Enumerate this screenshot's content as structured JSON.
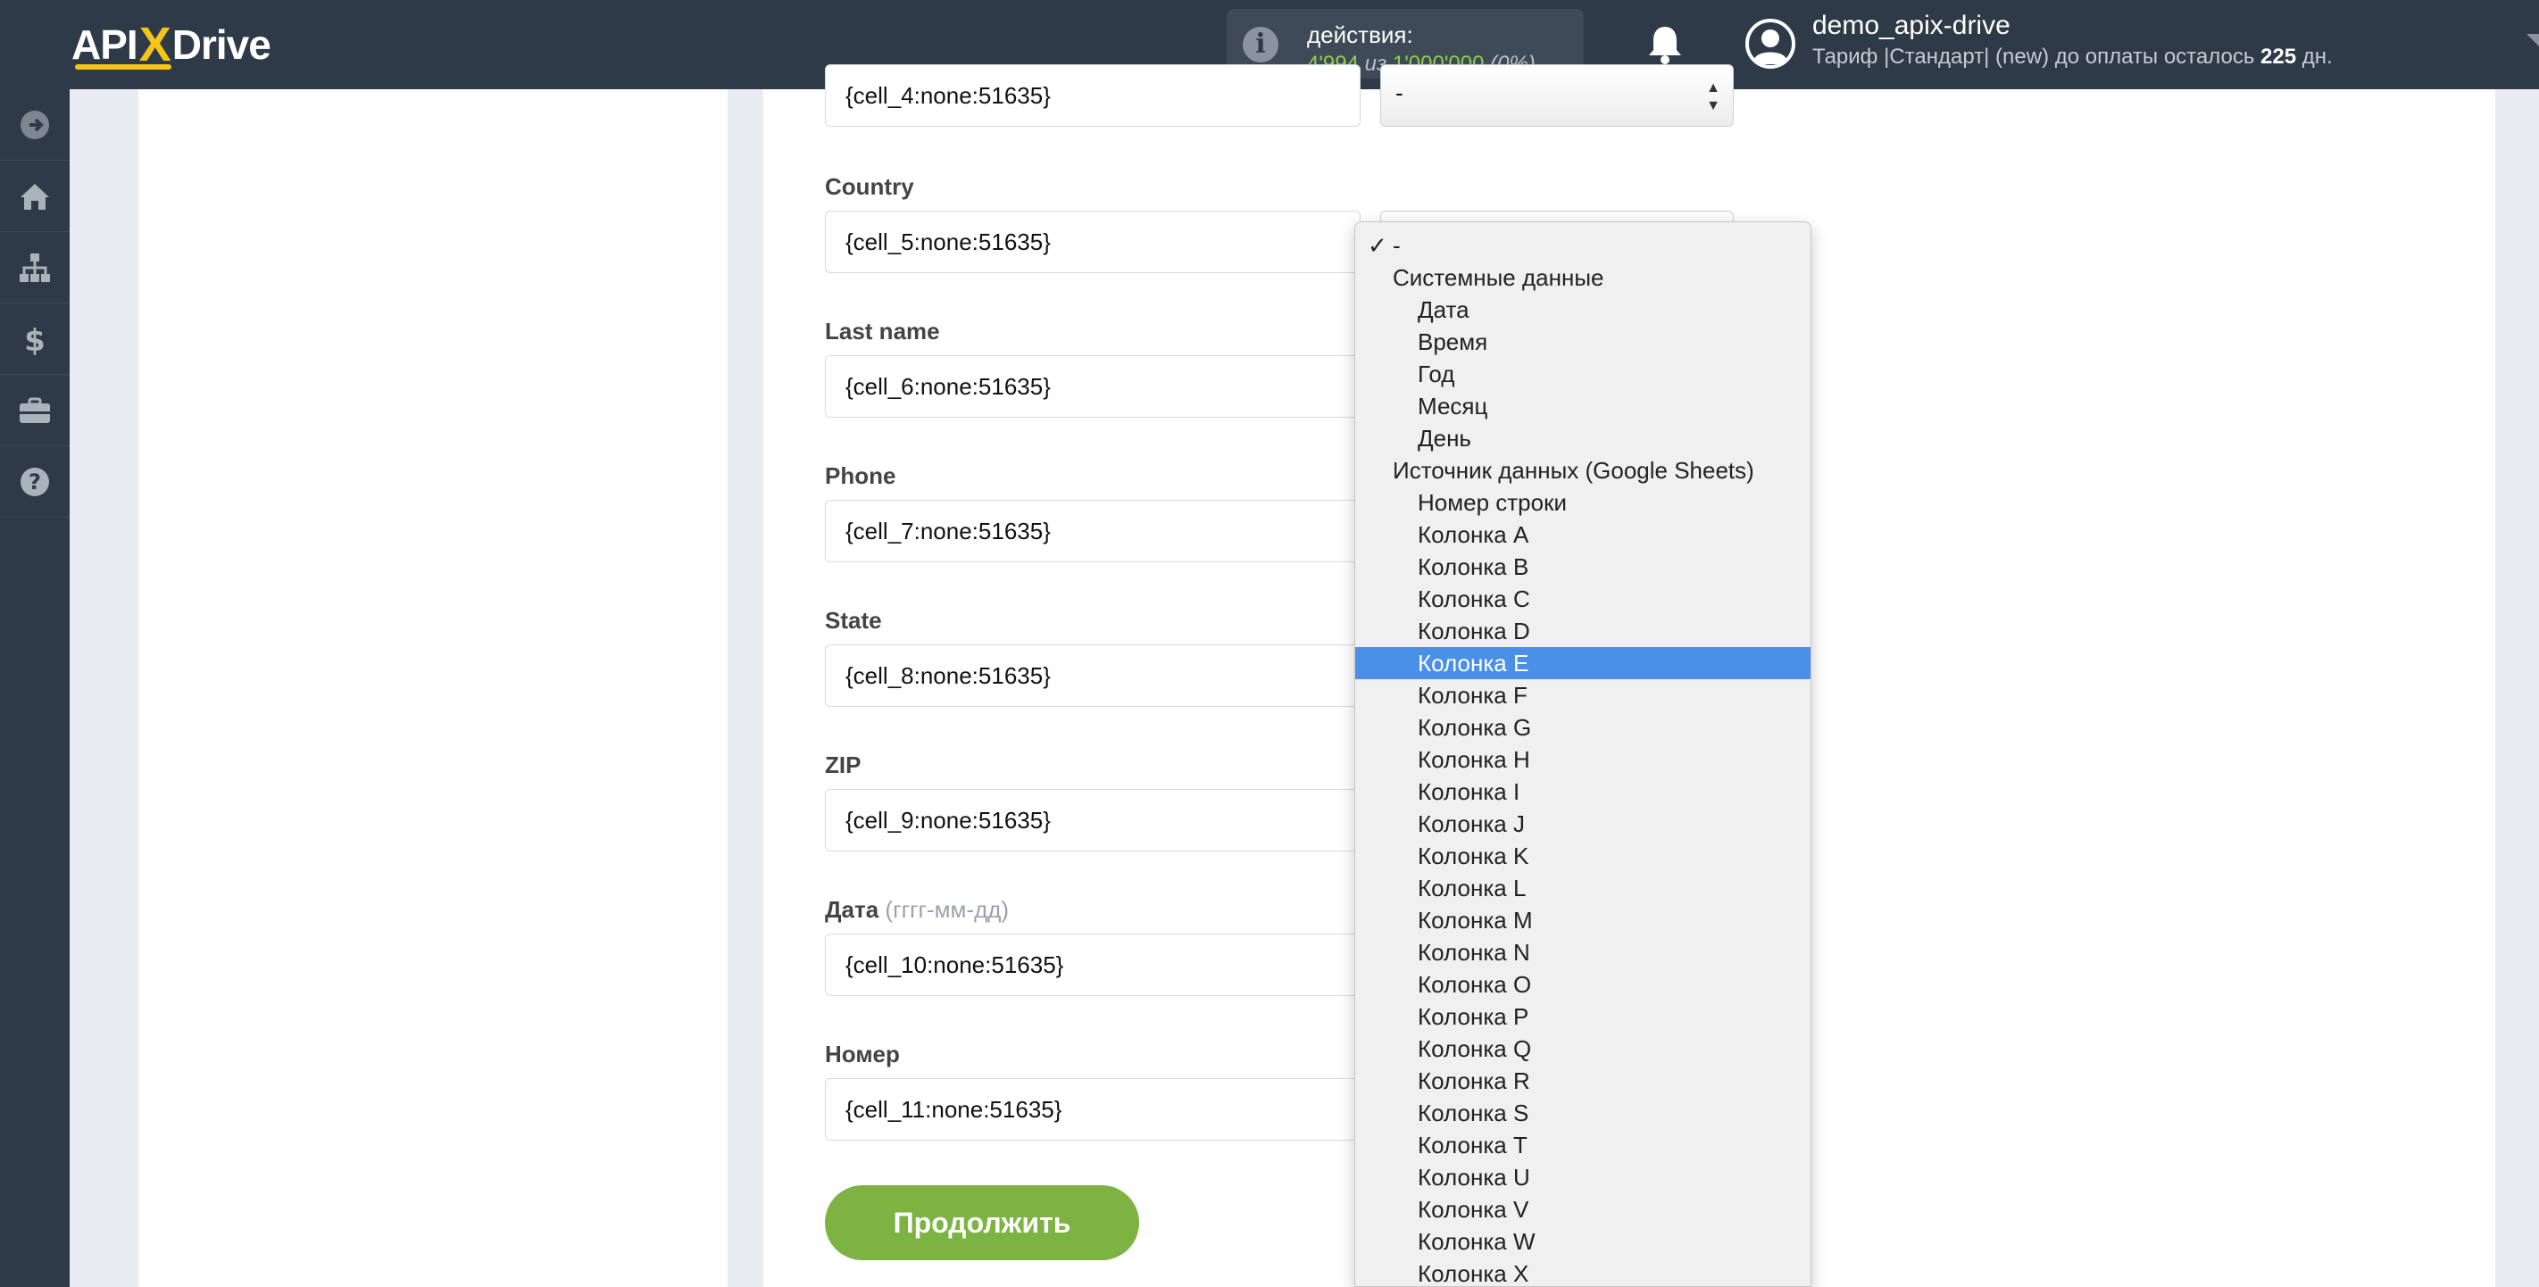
{
  "header": {
    "logo": {
      "part1": "API",
      "x": "X",
      "part2": "Drive"
    },
    "actions": {
      "label": "действия:",
      "used": "4'994",
      "of_word": "из",
      "total": "1'000'000",
      "percent": "(0%)"
    },
    "user": {
      "name": "demo_apix-drive",
      "plan_prefix": "Тариф |Стандарт| (new) до оплаты осталось",
      "days": "225",
      "days_suffix": "дн."
    }
  },
  "sidebar": {
    "items": [
      {
        "icon": "arrow-right-circle-icon"
      },
      {
        "icon": "home-icon"
      },
      {
        "icon": "sitemap-icon"
      },
      {
        "icon": "dollar-icon"
      },
      {
        "icon": "briefcase-icon"
      },
      {
        "icon": "help-icon"
      }
    ]
  },
  "form": {
    "fields": [
      {
        "label": "",
        "value": "{cell_4:none:51635}",
        "select": "-"
      },
      {
        "label": "Country",
        "value": "{cell_5:none:51635}",
        "select": ""
      },
      {
        "label": "Last name",
        "value": "{cell_6:none:51635}"
      },
      {
        "label": "Phone",
        "value": "{cell_7:none:51635}"
      },
      {
        "label": "State",
        "value": "{cell_8:none:51635}"
      },
      {
        "label": "ZIP",
        "value": "{cell_9:none:51635}"
      },
      {
        "label": "Дата",
        "hint": "(гггг-мм-дд)",
        "value": "{cell_10:none:51635}"
      },
      {
        "label": "Номер",
        "value": "{cell_11:none:51635}"
      }
    ],
    "continue_label": "Продолжить"
  },
  "dropdown": {
    "checkmark": "✓",
    "selected_index": 13,
    "items": [
      {
        "label": "-",
        "kind": "checked"
      },
      {
        "label": "Системные данные",
        "kind": "group"
      },
      {
        "label": "Дата",
        "kind": "sub"
      },
      {
        "label": "Время",
        "kind": "sub"
      },
      {
        "label": "Год",
        "kind": "sub"
      },
      {
        "label": "Месяц",
        "kind": "sub"
      },
      {
        "label": "День",
        "kind": "sub"
      },
      {
        "label": "Источник данных (Google Sheets)",
        "kind": "group"
      },
      {
        "label": "Номер строки",
        "kind": "sub"
      },
      {
        "label": "Колонка A",
        "kind": "sub"
      },
      {
        "label": "Колонка B",
        "kind": "sub"
      },
      {
        "label": "Колонка C",
        "kind": "sub"
      },
      {
        "label": "Колонка D",
        "kind": "sub"
      },
      {
        "label": "Колонка E",
        "kind": "sub"
      },
      {
        "label": "Колонка F",
        "kind": "sub"
      },
      {
        "label": "Колонка G",
        "kind": "sub"
      },
      {
        "label": "Колонка H",
        "kind": "sub"
      },
      {
        "label": "Колонка I",
        "kind": "sub"
      },
      {
        "label": "Колонка J",
        "kind": "sub"
      },
      {
        "label": "Колонка K",
        "kind": "sub"
      },
      {
        "label": "Колонка L",
        "kind": "sub"
      },
      {
        "label": "Колонка M",
        "kind": "sub"
      },
      {
        "label": "Колонка N",
        "kind": "sub"
      },
      {
        "label": "Колонка O",
        "kind": "sub"
      },
      {
        "label": "Колонка P",
        "kind": "sub"
      },
      {
        "label": "Колонка Q",
        "kind": "sub"
      },
      {
        "label": "Колонка R",
        "kind": "sub"
      },
      {
        "label": "Колонка S",
        "kind": "sub"
      },
      {
        "label": "Колонка T",
        "kind": "sub"
      },
      {
        "label": "Колонка U",
        "kind": "sub"
      },
      {
        "label": "Колонка V",
        "kind": "sub"
      },
      {
        "label": "Колонка W",
        "kind": "sub"
      },
      {
        "label": "Колонка X",
        "kind": "sub"
      }
    ]
  },
  "colors": {
    "header_bg": "#2e3a47",
    "accent_green": "#7cb342",
    "selection_blue": "#4a90e8",
    "logo_yellow": "#f5c518"
  }
}
